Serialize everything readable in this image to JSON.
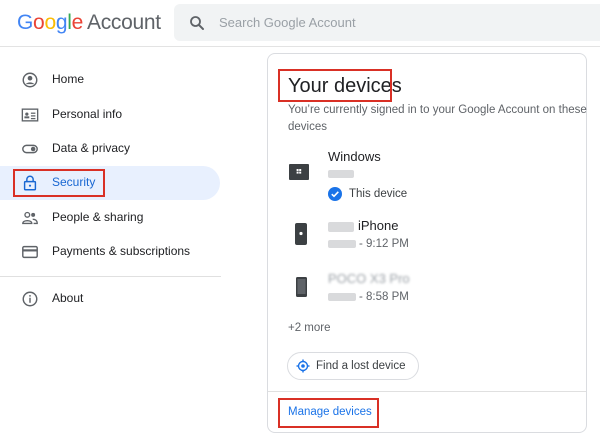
{
  "header": {
    "logo_letters": [
      "G",
      "o",
      "o",
      "g",
      "l",
      "e"
    ],
    "logo_suffix": "Account",
    "search_placeholder": "Search Google Account"
  },
  "sidebar": {
    "items": [
      {
        "label": "Home",
        "icon": "home-icon"
      },
      {
        "label": "Personal info",
        "icon": "id-card-icon"
      },
      {
        "label": "Data & privacy",
        "icon": "toggle-icon"
      },
      {
        "label": "Security",
        "icon": "lock-icon"
      },
      {
        "label": "People & sharing",
        "icon": "people-icon"
      },
      {
        "label": "Payments & subscriptions",
        "icon": "credit-card-icon"
      },
      {
        "label": "About",
        "icon": "info-icon"
      }
    ],
    "active": "Security"
  },
  "card": {
    "title": "Your devices",
    "description": "You’re currently signed in to your Google Account on these devices",
    "devices": [
      {
        "name": "Windows",
        "sub": "",
        "badge": "This device",
        "icon": "windows-desktop-icon"
      },
      {
        "name": "iPhone",
        "sub": "- 9:12 PM",
        "icon": "iphone-icon"
      },
      {
        "name": "POCO X3 Pro",
        "sub": "- 8:58 PM",
        "icon": "android-phone-icon"
      }
    ],
    "more": "+2 more",
    "find_button": "Find a lost device",
    "manage_link": "Manage devices"
  },
  "colors": {
    "accent": "#1a73e8",
    "active_bg": "#e8f0fe",
    "highlight_box": "#d93025"
  }
}
